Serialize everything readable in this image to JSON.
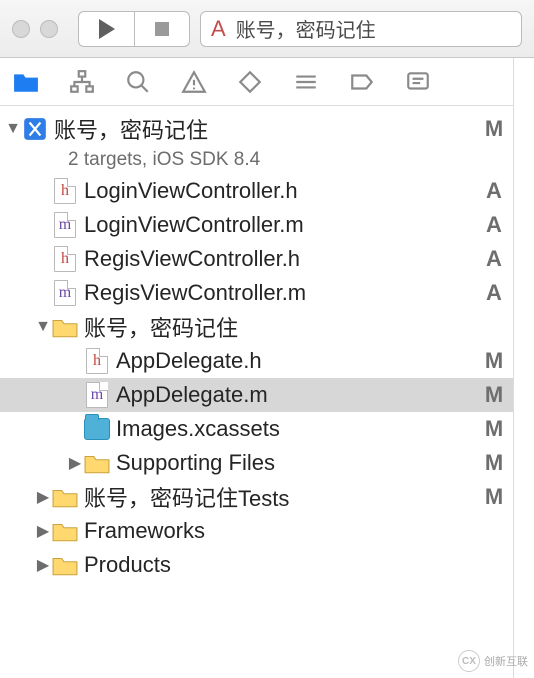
{
  "toolbar": {
    "scheme_text": "账号，密码记住"
  },
  "project": {
    "name": "账号，密码记住",
    "subtitle": "2 targets, iOS SDK 8.4",
    "status": "M"
  },
  "rows": [
    {
      "indent": 1,
      "icon": "h",
      "label": "LoginViewController.h",
      "status": "A",
      "disclosure": "",
      "interact": true
    },
    {
      "indent": 1,
      "icon": "m",
      "label": "LoginViewController.m",
      "status": "A",
      "disclosure": "",
      "interact": true
    },
    {
      "indent": 1,
      "icon": "h",
      "label": "RegisViewController.h",
      "status": "A",
      "disclosure": "",
      "interact": true
    },
    {
      "indent": 1,
      "icon": "m",
      "label": "RegisViewController.m",
      "status": "A",
      "disclosure": "",
      "interact": true
    },
    {
      "indent": 1,
      "icon": "folder",
      "label": "账号，密码记住",
      "status": "",
      "disclosure": "down",
      "interact": true
    },
    {
      "indent": 2,
      "icon": "h",
      "label": "AppDelegate.h",
      "status": "M",
      "disclosure": "",
      "interact": true
    },
    {
      "indent": 2,
      "icon": "m",
      "label": "AppDelegate.m",
      "status": "M",
      "disclosure": "",
      "interact": true,
      "selected": true
    },
    {
      "indent": 2,
      "icon": "assets",
      "label": "Images.xcassets",
      "status": "M",
      "disclosure": "",
      "interact": true
    },
    {
      "indent": 2,
      "icon": "folder",
      "label": "Supporting Files",
      "status": "M",
      "disclosure": "right",
      "interact": true
    },
    {
      "indent": 1,
      "icon": "folder",
      "label": "账号，密码记住Tests",
      "status": "M",
      "disclosure": "right",
      "interact": true
    },
    {
      "indent": 1,
      "icon": "folder",
      "label": "Frameworks",
      "status": "",
      "disclosure": "right",
      "interact": true
    },
    {
      "indent": 1,
      "icon": "folder",
      "label": "Products",
      "status": "",
      "disclosure": "right",
      "interact": true
    }
  ],
  "watermark": {
    "brand": "CX",
    "text": "创新互联"
  }
}
